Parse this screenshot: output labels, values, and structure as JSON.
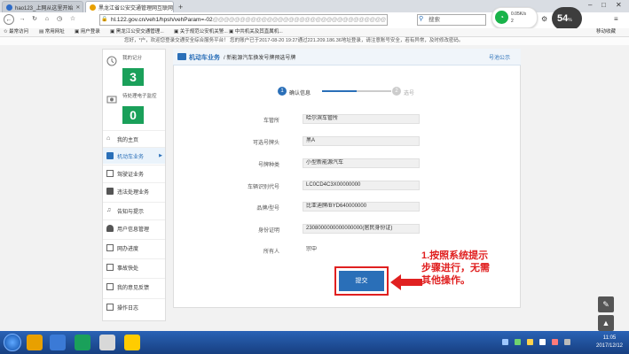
{
  "browser": {
    "tabs": [
      {
        "label": "hao123_上网从这里开始",
        "active": false
      },
      {
        "label": "黑龙江省公安交通管理网互联网",
        "active": true
      }
    ],
    "url_host": "hl.122.gov.cn",
    "url_path": "/veh1/hpsh/vehParam=-02",
    "url_obscured": "@@@@@@@@@@@@@@@@@@@@@@@@@@@@@@@@",
    "search_placeholder": "搜索",
    "bookmarks": [
      "最常访问",
      "常用网址",
      "用户登录",
      "黑龙江公安交通管理...",
      "关于规范公安机关警...",
      "中共机关及其直属机..."
    ],
    "mobile_bookmarks": "移动收藏",
    "notice": "您好，*户，欢迎您登录交通安全综合服务平台！  您的账户已于2017-08-20 19:27通过221.209.186.36地址登录，请注意账号安全，若有异常，及时修改密码。"
  },
  "widgets": {
    "wifi_speed_up": "0.05K/s",
    "wifi_count": "2",
    "speed_value": "54",
    "speed_unit": "%"
  },
  "sidebar": {
    "stats": [
      {
        "label": "我的记分",
        "value": "3"
      },
      {
        "label": "待处理电子监控",
        "value": "0"
      }
    ],
    "items": [
      {
        "label": "我的主页",
        "active": false
      },
      {
        "label": "机动车业务",
        "active": true
      },
      {
        "label": "驾驶证业务",
        "active": false
      },
      {
        "label": "违法处理业务",
        "active": false
      },
      {
        "label": "告知与提示",
        "active": false
      },
      {
        "label": "用户信息管理",
        "active": false
      },
      {
        "label": "网办进度",
        "active": false
      },
      {
        "label": "事故快处",
        "active": false
      },
      {
        "label": "我的意见反馈",
        "active": false
      },
      {
        "label": "操作日志",
        "active": false
      }
    ]
  },
  "content": {
    "section": "机动车业务",
    "subtitle": "/ 新能源汽车换发号牌预选号牌",
    "link": "号池公示",
    "steps": [
      {
        "num": "1",
        "label": "确认信息"
      },
      {
        "num": "2",
        "label": "选号"
      }
    ],
    "fields": [
      {
        "label": "车管所",
        "value": "哈尔滨车管所"
      },
      {
        "label": "可选号牌头",
        "value": "黑A"
      },
      {
        "label": "号牌种类",
        "value": "小型新能源汽车"
      },
      {
        "label": "车辆识别代号",
        "value": "LC0CD4C3X00000000"
      },
      {
        "label": "品牌/型号",
        "value": "比亚迪牌/BYD640000000"
      },
      {
        "label": "身份证明",
        "value": "2308000000000000000(居民身份证)"
      },
      {
        "label": "所有人",
        "value": "宗中"
      }
    ],
    "submit_label": "提交"
  },
  "annotation": {
    "text": "1.按照系统提示步骤进行，无需其他操作。"
  },
  "taskbar": {
    "time": "11:05",
    "date": "2017/12/12"
  }
}
